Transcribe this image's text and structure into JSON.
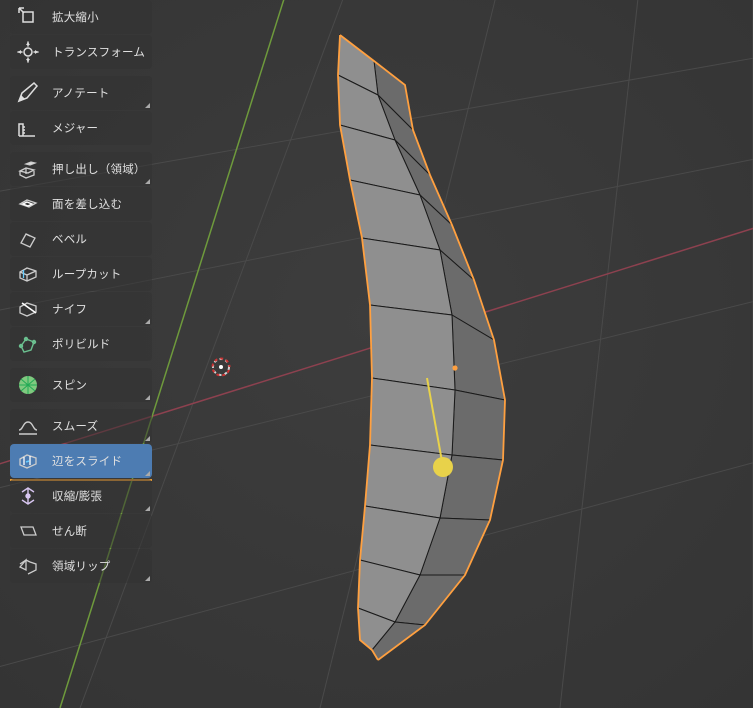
{
  "colors": {
    "bg": "#393939",
    "toolbar_bg": "#31313180",
    "active": "#4d7cb2",
    "active_underline": "#e69b36",
    "text": "#e0e0e0",
    "x_axis": "#a34252",
    "y_axis": "#6e9a3c",
    "grid": "#4a4a4a",
    "mesh_fill": "#8f8f8f",
    "mesh_fill_dark": "#6f6f6f",
    "mesh_edge": "#1a1a1a",
    "selection": "#ffa040",
    "gizmo": "#f0d040"
  },
  "active_tool_index": 12,
  "tools": [
    {
      "id": "scale",
      "label": "拡大縮小",
      "icon": "scale",
      "corner": false
    },
    {
      "id": "transform",
      "label": "トランスフォーム",
      "icon": "transform",
      "corner": false
    },
    {
      "id": "annotate",
      "label": "アノテート",
      "icon": "annotate",
      "corner": true,
      "group_start": true
    },
    {
      "id": "measure",
      "label": "メジャー",
      "icon": "measure",
      "corner": false
    },
    {
      "id": "extrude",
      "label": "押し出し（領域）",
      "icon": "extrude",
      "corner": true,
      "group_start": true
    },
    {
      "id": "inset",
      "label": "面を差し込む",
      "icon": "inset",
      "corner": false
    },
    {
      "id": "bevel",
      "label": "ベベル",
      "icon": "bevel",
      "corner": false
    },
    {
      "id": "loopcut",
      "label": "ループカット",
      "icon": "loopcut",
      "corner": false
    },
    {
      "id": "knife",
      "label": "ナイフ",
      "icon": "knife",
      "corner": true
    },
    {
      "id": "polybuild",
      "label": "ポリビルド",
      "icon": "polybuild",
      "corner": false
    },
    {
      "id": "spin",
      "label": "スピン",
      "icon": "spin",
      "corner": true,
      "group_start": true
    },
    {
      "id": "smooth",
      "label": "スムーズ",
      "icon": "smooth",
      "corner": true,
      "group_start": true
    },
    {
      "id": "edgeslide",
      "label": "辺をスライド",
      "icon": "edgeslide",
      "corner": true
    },
    {
      "id": "shrinkfatten",
      "label": "収縮/膨張",
      "icon": "shrinkfatten",
      "corner": true
    },
    {
      "id": "shear",
      "label": "せん断",
      "icon": "shear",
      "corner": false
    },
    {
      "id": "regionrip",
      "label": "領域リップ",
      "icon": "regionrip",
      "corner": true
    }
  ]
}
